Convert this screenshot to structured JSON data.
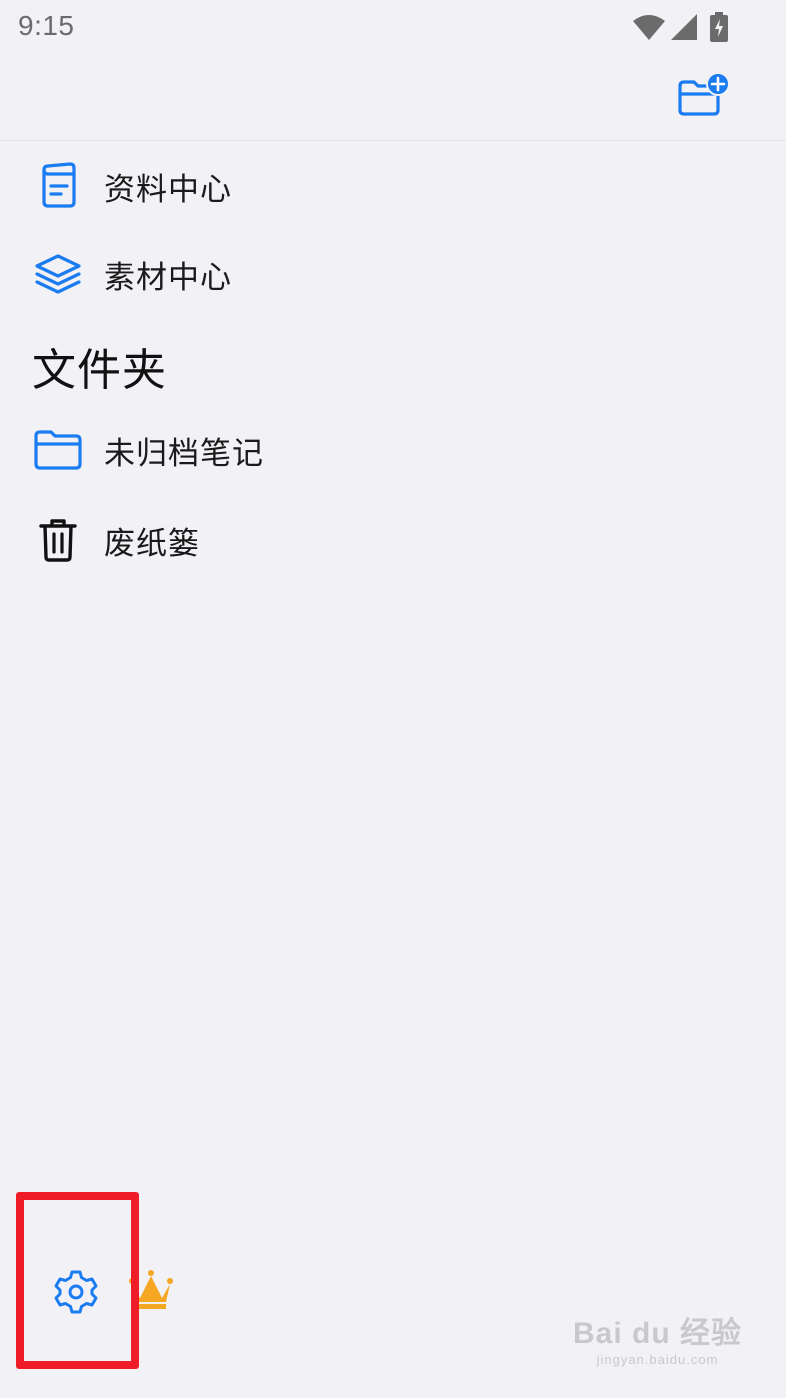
{
  "status_bar": {
    "time": "9:15",
    "icons": [
      "wifi-icon",
      "cell-signal-icon",
      "battery-charging-icon"
    ]
  },
  "header": {
    "new_folder_icon": "folder-plus-icon"
  },
  "nav": {
    "items": [
      {
        "label": "资料中心",
        "icon": "document-icon"
      },
      {
        "label": "素材中心",
        "icon": "layers-icon"
      }
    ]
  },
  "folders": {
    "heading": "文件夹",
    "items": [
      {
        "label": "未归档笔记",
        "icon": "folder-icon"
      },
      {
        "label": "废纸篓",
        "icon": "trash-icon"
      }
    ]
  },
  "bottom": {
    "settings_icon": "gear-icon",
    "vip_icon": "crown-icon"
  },
  "watermark": {
    "brand": "Bai du 经验",
    "url": "jingyan.baidu.com"
  },
  "colors": {
    "accent": "#1a7cf0",
    "background": "#f2f1f6",
    "highlight": "#ee1d27",
    "crown": "#f5a623"
  }
}
